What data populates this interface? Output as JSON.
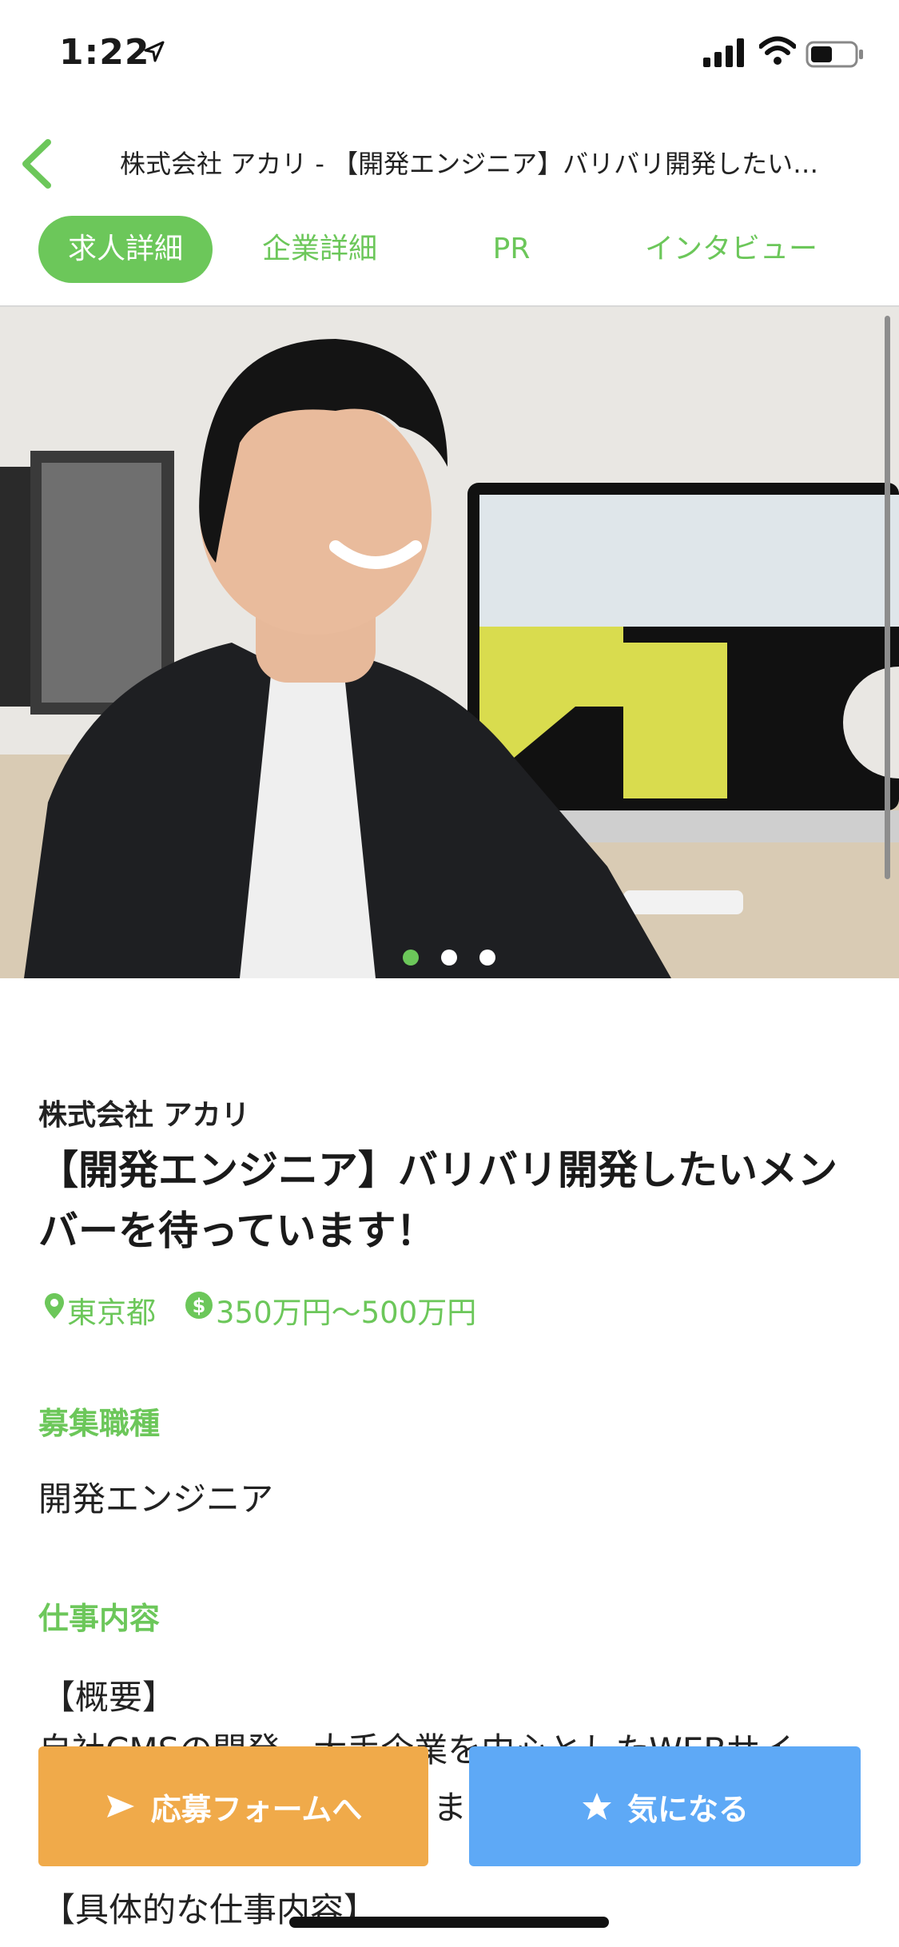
{
  "status_bar": {
    "time": "1:22"
  },
  "nav": {
    "title": "株式会社 アカリ - 【開発エンジニア】バリバリ開発したい…"
  },
  "tabs": [
    {
      "label": "求人詳細",
      "active": true
    },
    {
      "label": "企業詳細",
      "active": false
    },
    {
      "label": "PR",
      "active": false
    },
    {
      "label": "インタビュー",
      "active": false
    }
  ],
  "carousel": {
    "page_count": 3,
    "current_page": 1
  },
  "job": {
    "company": "株式会社 アカリ",
    "title": "【開発エンジニア】バリバリ開発したいメンバーを待っています！",
    "location": "東京都",
    "salary": "350万円〜500万円"
  },
  "sections": {
    "job_type_heading": "募集職種",
    "job_type_value": "開発エンジニア",
    "work_heading": "仕事内容",
    "overview_label": "【概要】",
    "overview_text": "自社CMSの開発　大手企業を中心としたWEBサイ",
    "overview_text_2": "ま",
    "detail_label": "【具体的な仕事内容】"
  },
  "actions": {
    "apply_label": "応募フォームへ",
    "favorite_label": "気になる"
  },
  "colors": {
    "accent": "#6cc75a",
    "apply": "#f0aa4a",
    "favorite": "#5ea9f6"
  }
}
